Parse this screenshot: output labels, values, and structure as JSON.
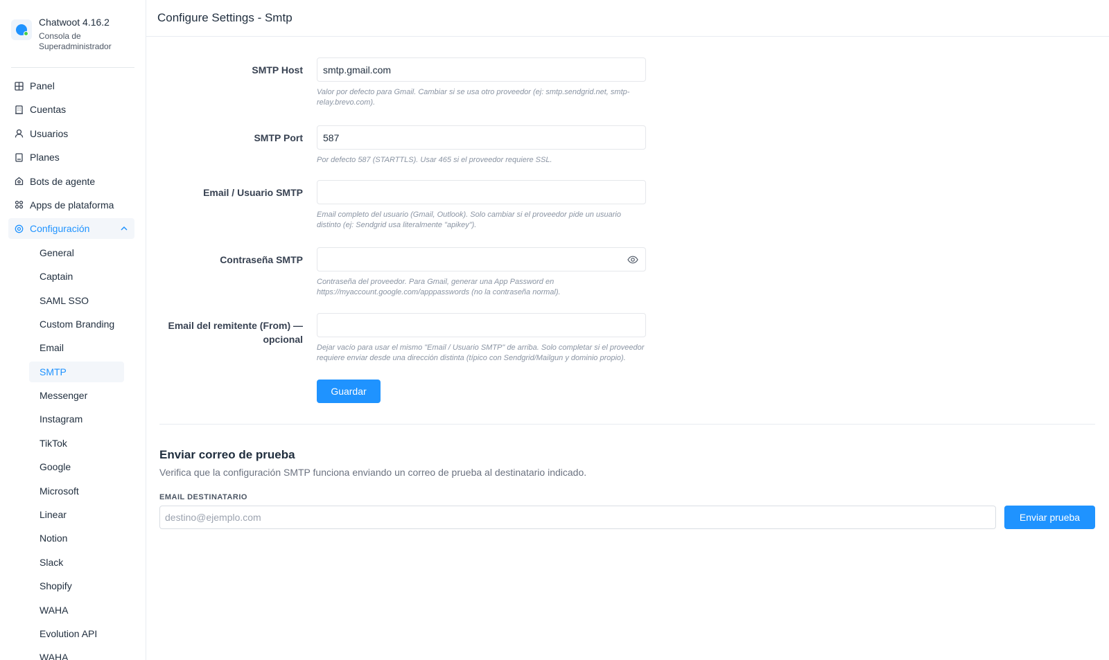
{
  "brand": {
    "title": "Chatwoot 4.16.2",
    "subtitle": "Consola de Superadministrador"
  },
  "nav": {
    "items": [
      {
        "label": "Panel",
        "icon": "grid-icon"
      },
      {
        "label": "Cuentas",
        "icon": "building-icon"
      },
      {
        "label": "Usuarios",
        "icon": "user-icon"
      },
      {
        "label": "Planes",
        "icon": "receipt-icon"
      },
      {
        "label": "Bots de agente",
        "icon": "bot-icon"
      },
      {
        "label": "Apps de plataforma",
        "icon": "apps-icon"
      },
      {
        "label": "Configuración",
        "icon": "gear-icon"
      }
    ],
    "settings_items": [
      "General",
      "Captain",
      "SAML SSO",
      "Custom Branding",
      "Email",
      "SMTP",
      "Messenger",
      "Instagram",
      "TikTok",
      "Google",
      "Microsoft",
      "Linear",
      "Notion",
      "Slack",
      "Shopify",
      "WAHA",
      "Evolution API",
      "WAHA"
    ],
    "active_settings_item": "SMTP"
  },
  "header": {
    "title": "Configure Settings - Smtp"
  },
  "form": {
    "smtp_host": {
      "label": "SMTP Host",
      "value": "smtp.gmail.com",
      "help": "Valor por defecto para Gmail. Cambiar si se usa otro proveedor (ej: smtp.sendgrid.net, smtp-relay.brevo.com)."
    },
    "smtp_port": {
      "label": "SMTP Port",
      "value": "587",
      "help": "Por defecto 587 (STARTTLS). Usar 465 si el proveedor requiere SSL."
    },
    "smtp_user": {
      "label": "Email / Usuario SMTP",
      "value": "",
      "help": "Email completo del usuario (Gmail, Outlook). Solo cambiar si el proveedor pide un usuario distinto (ej: Sendgrid usa literalmente \"apikey\")."
    },
    "smtp_password": {
      "label": "Contraseña SMTP",
      "value": "",
      "help": "Contraseña del proveedor. Para Gmail, generar una App Password en https://myaccount.google.com/apppasswords (no la contraseña normal)."
    },
    "smtp_from": {
      "label": "Email del remitente (From) — opcional",
      "value": "",
      "help": "Dejar vacío para usar el mismo \"Email / Usuario SMTP\" de arriba. Solo completar si el proveedor requiere enviar desde una dirección distinta (típico con Sendgrid/Mailgun y dominio propio)."
    },
    "save_label": "Guardar"
  },
  "test": {
    "title": "Enviar correo de prueba",
    "description": "Verifica que la configuración SMTP funciona enviando un correo de prueba al destinatario indicado.",
    "field_label": "EMAIL DESTINATARIO",
    "placeholder": "destino@ejemplo.com",
    "button_label": "Enviar prueba"
  },
  "colors": {
    "accent": "#1f93ff",
    "online": "#44ce4b"
  }
}
